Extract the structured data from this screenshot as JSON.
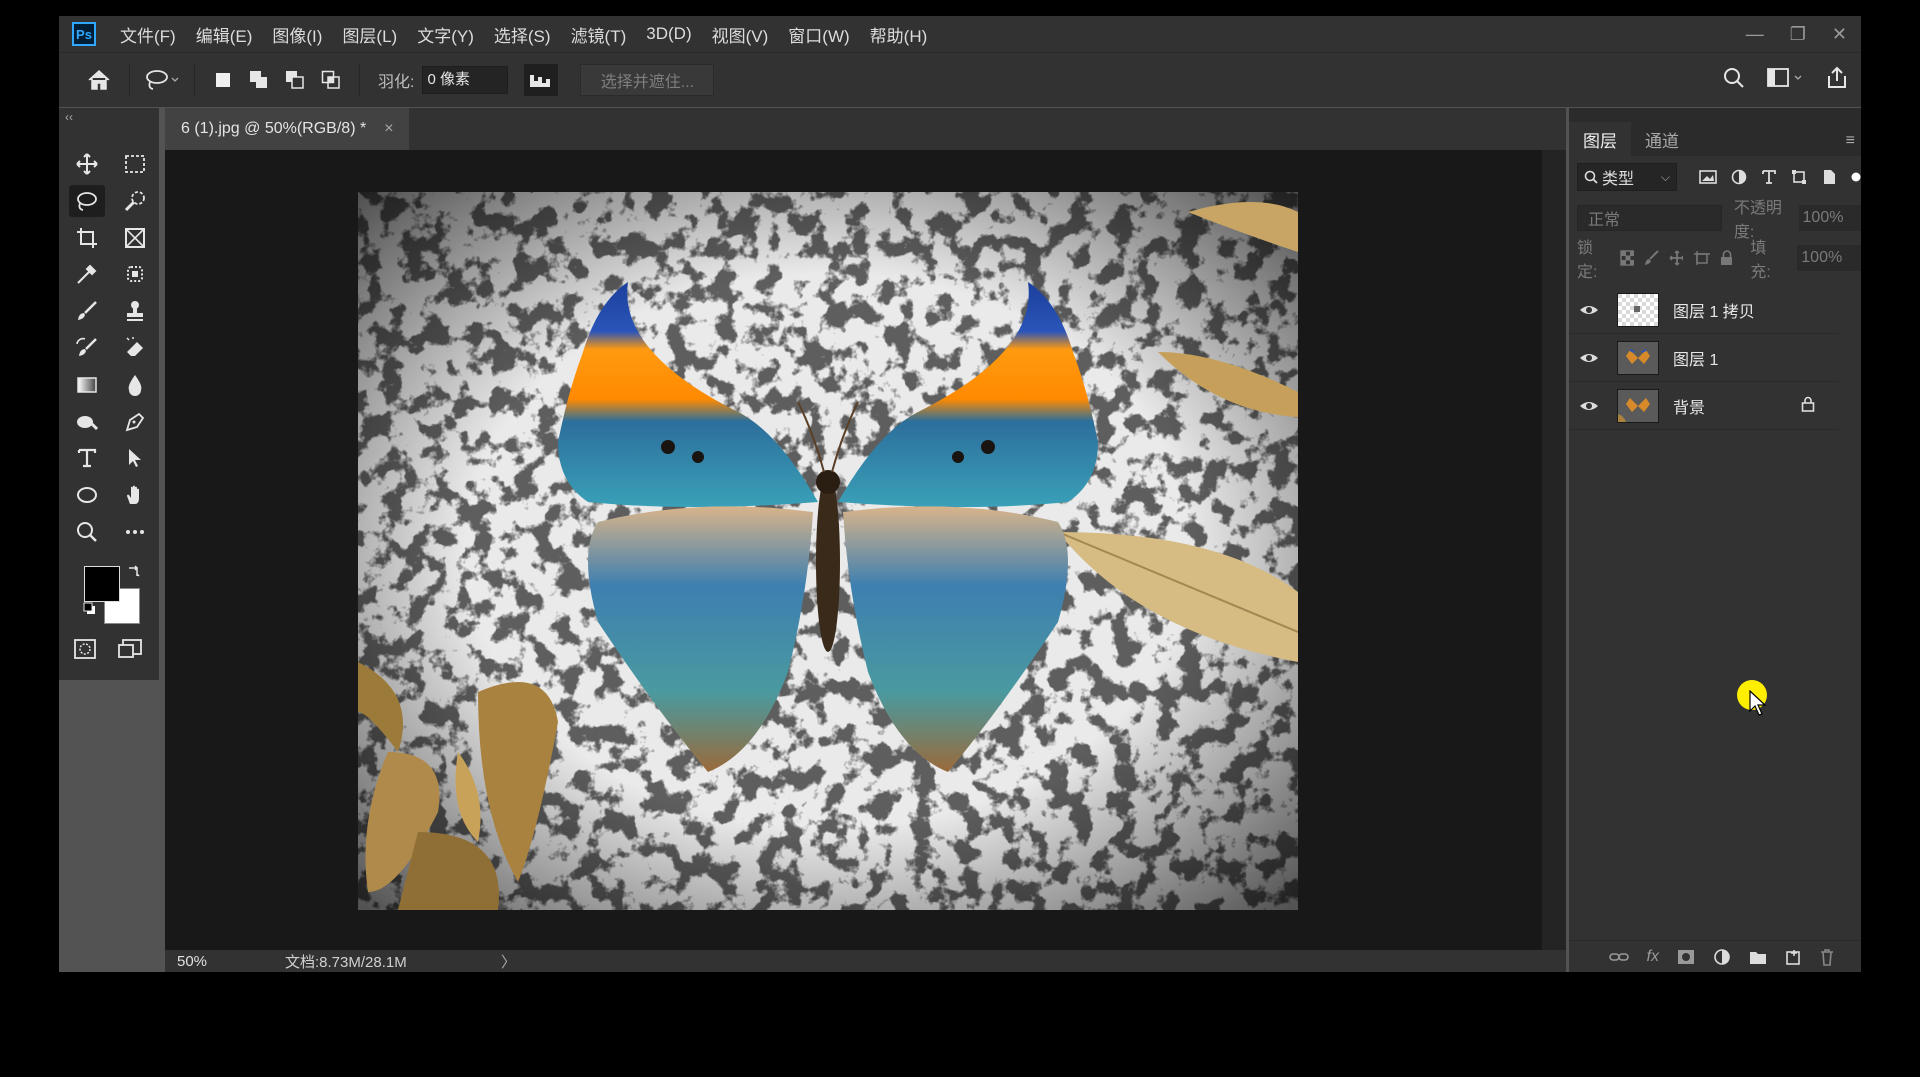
{
  "menu": {
    "logo": "Ps",
    "items": [
      "文件(F)",
      "编辑(E)",
      "图像(I)",
      "图层(L)",
      "文字(Y)",
      "选择(S)",
      "滤镜(T)",
      "3D(D)",
      "视图(V)",
      "窗口(W)",
      "帮助(H)"
    ],
    "window_controls": [
      "—",
      "❐",
      "✕"
    ]
  },
  "options": {
    "feather_label": "羽化:",
    "feather_value": "0 像素",
    "select_and_mask": "选择并遮住..."
  },
  "document": {
    "tab_title": "6 (1).jpg @ 50%(RGB/8) *",
    "tab_close": "×",
    "zoom": "50%",
    "doc_info": "文档:8.73M/28.1M",
    "status_arrow": "〉"
  },
  "panel": {
    "tabs": [
      "图层",
      "通道"
    ],
    "filter_kind": "类型",
    "blend_mode": "正常",
    "opacity_label": "不透明度:",
    "opacity_value": "100%",
    "lock_label": "锁定:",
    "fill_label": "填充:",
    "fill_value": "100%",
    "layers": [
      {
        "name": "图层 1 拷贝",
        "visible": true,
        "locked": false
      },
      {
        "name": "图层 1",
        "visible": true,
        "locked": false
      },
      {
        "name": "背景",
        "visible": true,
        "locked": true
      }
    ]
  },
  "tools": [
    "move-icon",
    "marquee-icon",
    "lasso-icon",
    "quick-select-icon",
    "crop-icon",
    "frame-icon",
    "eyedropper-icon",
    "patch-icon",
    "brush-icon",
    "stamp-icon",
    "history-brush-icon",
    "eraser-icon",
    "gradient-icon",
    "blur-icon",
    "dodge-icon",
    "pen-icon",
    "type-icon",
    "path-select-icon",
    "ellipse-icon",
    "hand-icon",
    "zoom-icon",
    "more-icon"
  ],
  "colors": {
    "accent": "#31a8ff",
    "cursor_highlight": "#ffee00",
    "foreground": "#000000",
    "background": "#ffffff"
  }
}
